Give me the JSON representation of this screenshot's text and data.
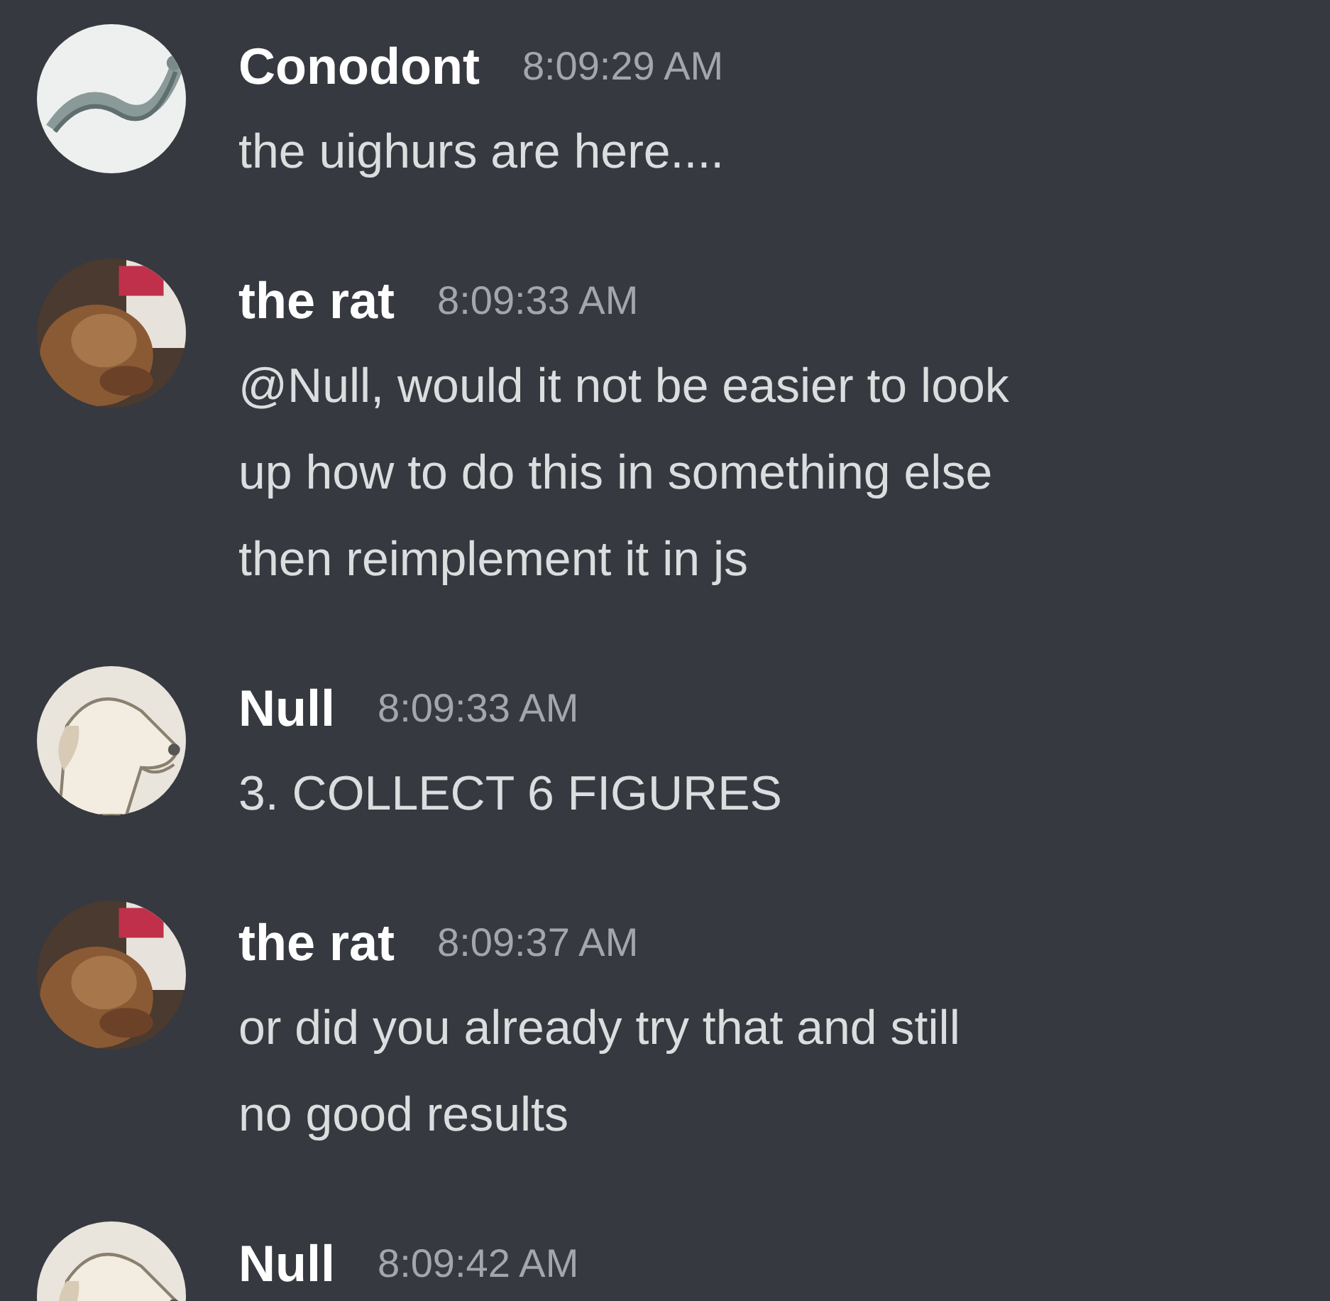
{
  "messages": [
    {
      "author": "Conodont",
      "time": "8:09:29 AM",
      "avatar": {
        "kind": "picture"
      },
      "lines": [
        "the uighurs are here...."
      ]
    },
    {
      "author": "the rat",
      "time": "8:09:33 AM",
      "avatar": {
        "kind": "picture"
      },
      "lines": [
        "@Null, would it not be easier to look",
        "up how to do this in something else",
        "then reimplement it in js"
      ]
    },
    {
      "author": "Null",
      "time": "8:09:33 AM",
      "avatar": {
        "kind": "picture"
      },
      "lines": [
        "3. COLLECT 6 FIGURES"
      ]
    },
    {
      "author": "the rat",
      "time": "8:09:37 AM",
      "avatar": {
        "kind": "picture"
      },
      "lines": [
        "or did you already try that and still",
        "no good results"
      ]
    },
    {
      "author": "Null",
      "time": "8:09:42 AM",
      "avatar": {
        "kind": "picture"
      }
    }
  ]
}
